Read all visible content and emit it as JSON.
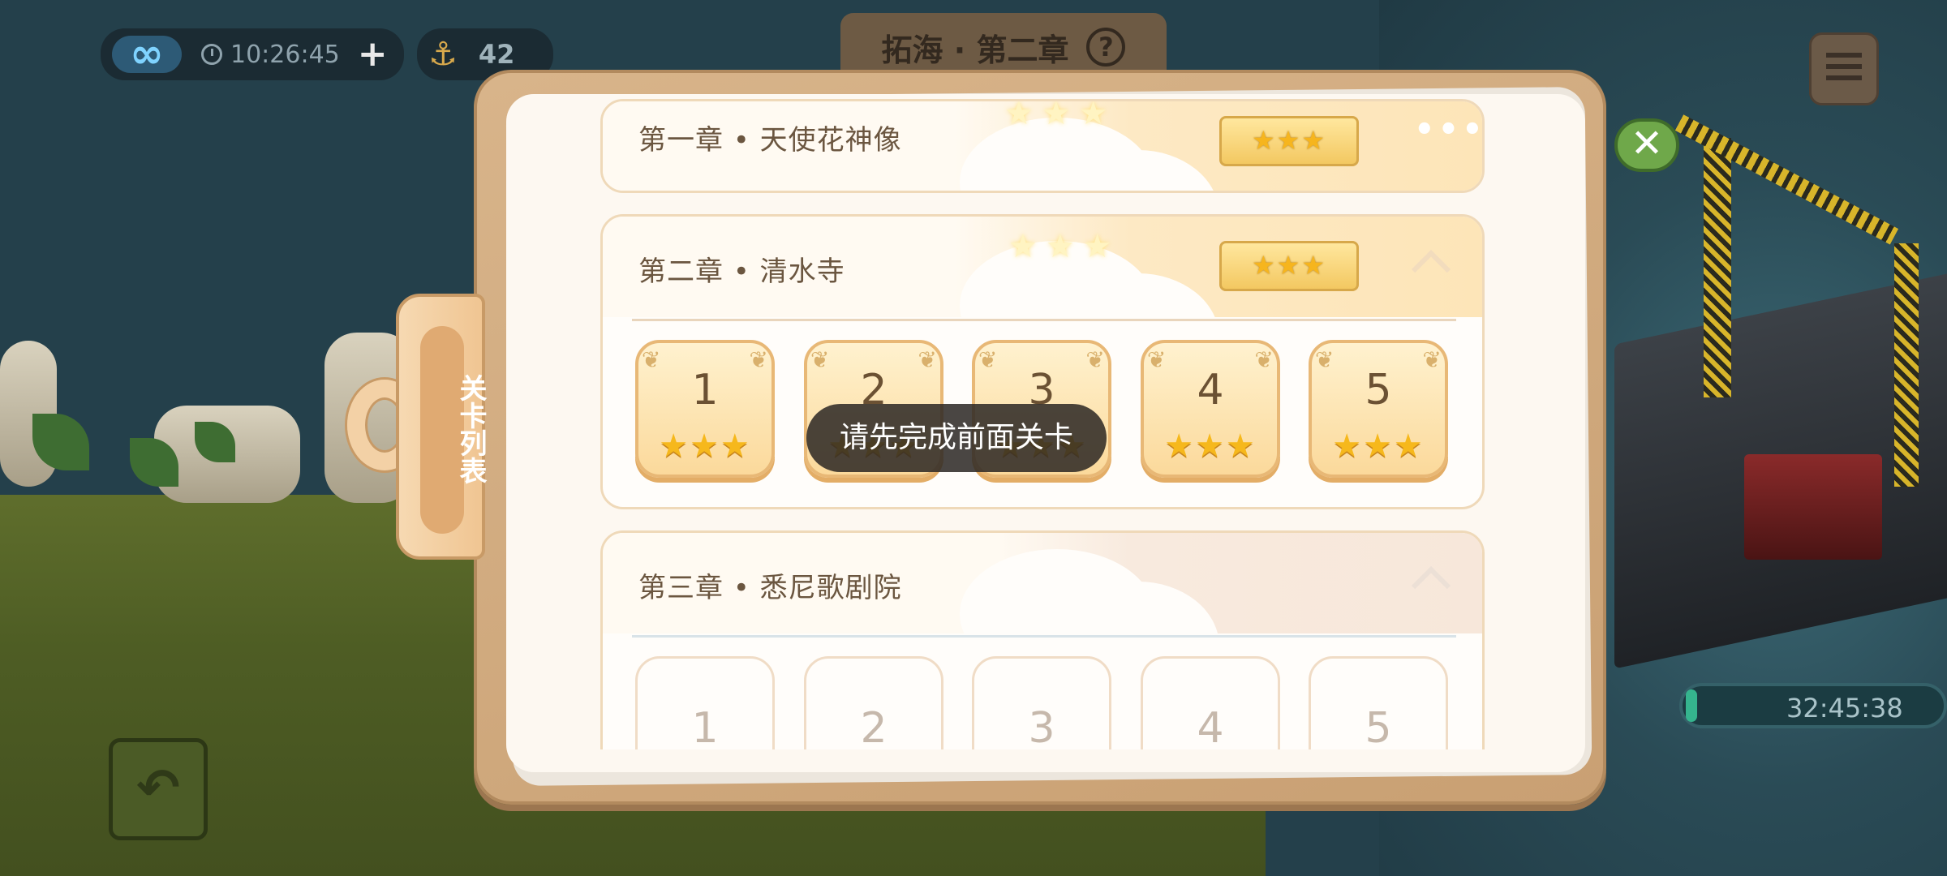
{
  "hud": {
    "time": "10:26:45",
    "anchor_count": "42",
    "chapter_title": "拓海 · 第二章",
    "timer": "32:45:38",
    "timer_progress": 0.02
  },
  "side_tab": {
    "label": "关卡列表"
  },
  "chapters": [
    {
      "title": "第一章 • 天使花神像",
      "state": "completed",
      "rating_stars": 3
    },
    {
      "title": "第二章 • 清水寺",
      "state": "completed",
      "rating_stars": 3,
      "levels": [
        {
          "number": "1",
          "stars": 3
        },
        {
          "number": "2",
          "stars": 3
        },
        {
          "number": "3",
          "stars": 3
        },
        {
          "number": "4",
          "stars": 3
        },
        {
          "number": "5",
          "stars": 3
        }
      ]
    },
    {
      "title": "第三章 • 悉尼歌剧院",
      "state": "locked",
      "levels": [
        {
          "number": "1"
        },
        {
          "number": "2"
        },
        {
          "number": "3"
        },
        {
          "number": "4"
        },
        {
          "number": "5"
        }
      ]
    }
  ],
  "toast": "请先完成前面关卡",
  "icons": {
    "infinity": "infinity-icon",
    "clock": "clock-icon",
    "anchor": "anchor-icon",
    "help": "help-icon",
    "calendar": "calendar-icon",
    "close": "close-icon",
    "back": "back-arrow-icon",
    "more": "more-icon",
    "chevron": "chevron-up-icon",
    "star": "star-icon"
  },
  "colors": {
    "star_gold": "#f6b81c",
    "panel_wood": "#d8b48a",
    "close_green": "#6fa84a"
  }
}
